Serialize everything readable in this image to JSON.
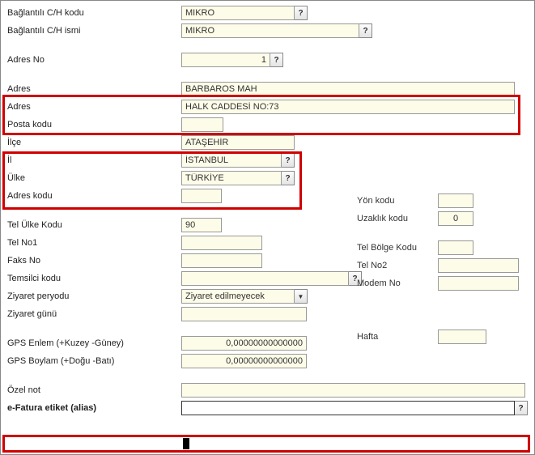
{
  "labels": {
    "bagCHKodu": "Bağlantılı C/H kodu",
    "bagCHIsmi": "Bağlantılı C/H ismi",
    "adresNo": "Adres No",
    "adres": "Adres",
    "postaKodu": "Posta kodu",
    "ilce": "İlçe",
    "il": "İl",
    "ulke": "Ülke",
    "yonKodu": "Yön kodu",
    "adresKodu": "Adres kodu",
    "uzaklikKodu": "Uzaklık kodu",
    "telUlke": "Tel Ülke Kodu",
    "telBolge": "Tel Bölge Kodu",
    "telNo1": "Tel No1",
    "telNo2": "Tel No2",
    "faksNo": "Faks No",
    "modemNo": "Modem No",
    "temsilci": "Temsilci kodu",
    "ziyaretP": "Ziyaret peryodu",
    "ziyaretG": "Ziyaret günü",
    "hafta": "Hafta",
    "gpsEnlem": "GPS Enlem (+Kuzey -Güney)",
    "gpsBoylam": "GPS Boylam (+Doğu -Batı)",
    "ozelNot": "Özel not",
    "efatura": "e-Fatura etiket (alias)"
  },
  "values": {
    "bagCHKodu": "MIKRO",
    "bagCHIsmi": "MIKRO",
    "adresNo": "1",
    "adres1": "BARBAROS MAH",
    "adres2": "HALK CADDESİ NO:73",
    "postaKodu": "",
    "ilce": "ATAŞEHİR",
    "il": "İSTANBUL",
    "ulke": "TÜRKİYE",
    "yonKodu": "",
    "adresKodu": "",
    "uzaklikKodu": "0",
    "telUlke": "90",
    "telBolge": "",
    "telNo1": "",
    "telNo2": "",
    "faksNo": "",
    "modemNo": "",
    "temsilci": "",
    "ziyaretP": "Ziyaret edilmeyecek",
    "ziyaretG": "",
    "hafta": "",
    "gpsEnlem": "0,00000000000000",
    "gpsBoylam": "0,00000000000000",
    "ozelNot": "",
    "efatura": ""
  },
  "glyph": {
    "help": "?",
    "drop": "▼"
  }
}
